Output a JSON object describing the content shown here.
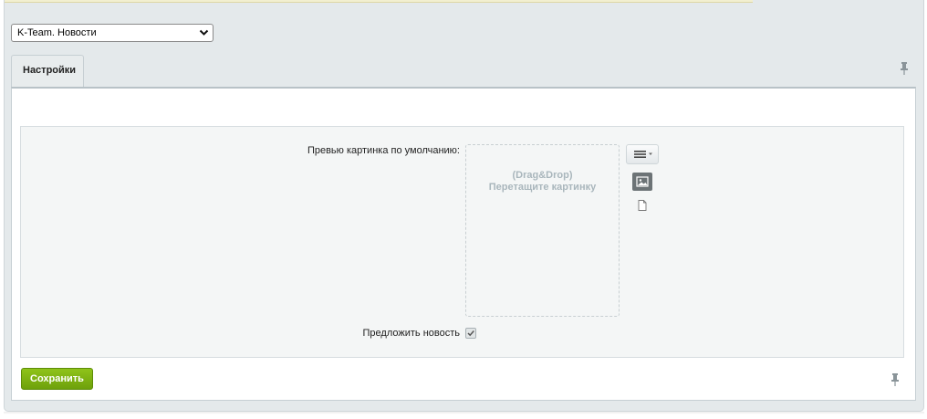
{
  "site_select": {
    "selected_value": "K-Team. Новости"
  },
  "tabs": [
    {
      "label": "Настройки"
    }
  ],
  "form": {
    "preview_image_label": "Превью картинка по умолчанию:",
    "dropzone": {
      "line1": "(Drag&Drop)",
      "line2": "Перетащите картинку"
    },
    "suggest_news_label": "Предложить новость",
    "suggest_news_checked": true
  },
  "actions": {
    "save_label": "Сохранить"
  },
  "icons": {
    "select_arrow": "chevron-down-icon",
    "pin": "pin-icon",
    "menu": "menu-lines-icon",
    "image": "image-icon",
    "file": "file-icon",
    "checkbox": "checkmark-icon"
  },
  "colors": {
    "save_button": "#7bb212",
    "panel_bg": "#e4e9eb",
    "form_bg": "#f4f6f6",
    "dropzone_text": "#a9b6bc"
  }
}
